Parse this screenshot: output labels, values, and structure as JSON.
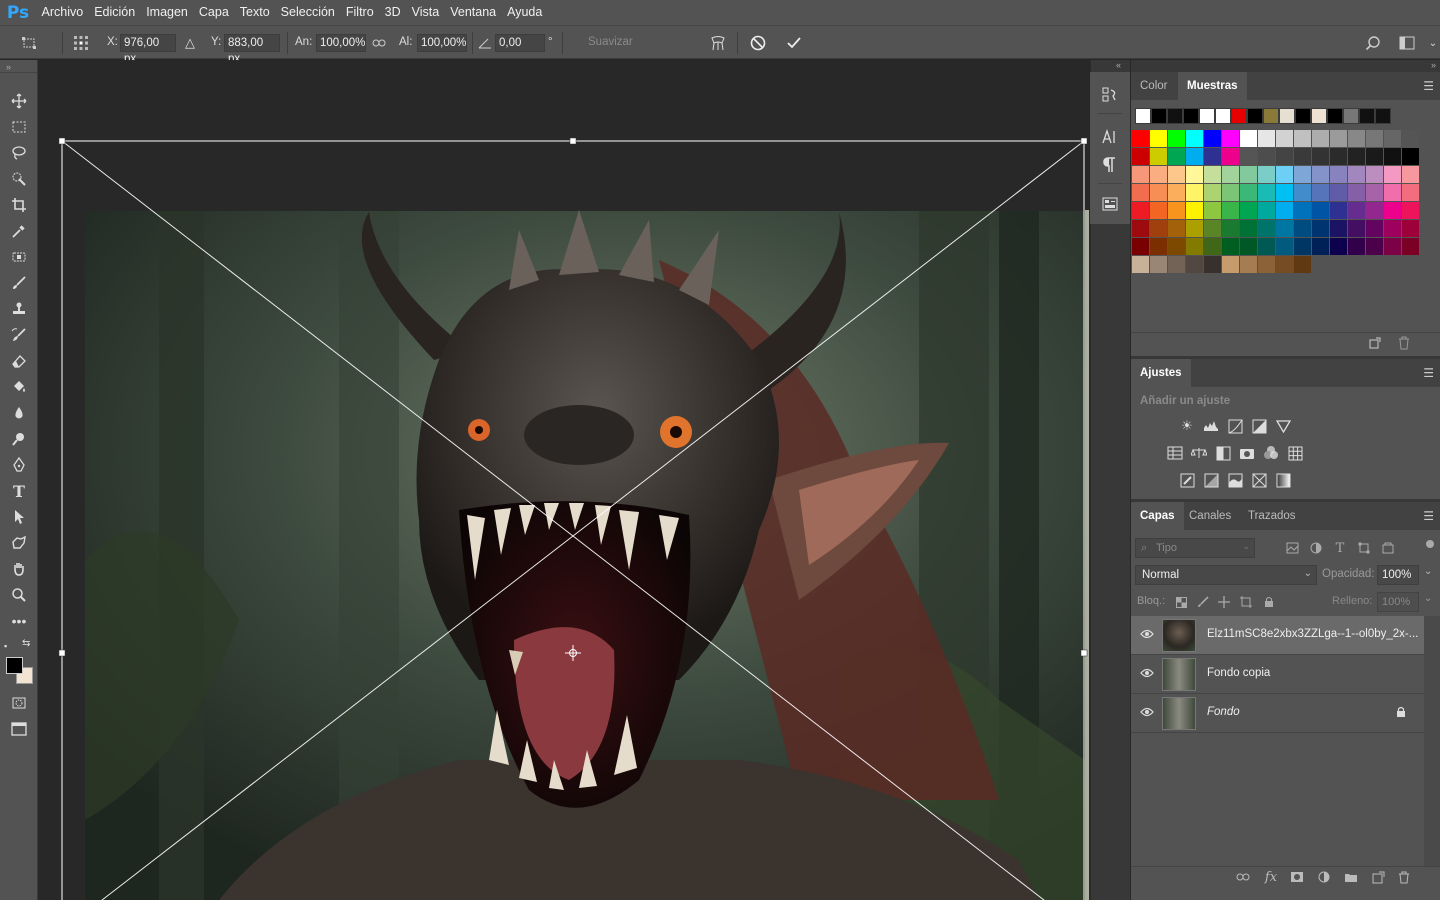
{
  "app": {
    "logo": "Ps"
  },
  "menu": [
    "Archivo",
    "Edición",
    "Imagen",
    "Capa",
    "Texto",
    "Selección",
    "Filtro",
    "3D",
    "Vista",
    "Ventana",
    "Ayuda"
  ],
  "options": {
    "x_label": "X:",
    "x_value": "976,00 px",
    "y_label": "Y:",
    "y_value": "883,00 px",
    "w_label": "An:",
    "w_value": "100,00%",
    "h_label": "Al:",
    "h_value": "100,00%",
    "angle_value": "0,00",
    "angle_unit": "°",
    "smooth_label": "Suavizar"
  },
  "color_panel": {
    "tabs": [
      "Color",
      "Muestras"
    ],
    "active_tab": "Muestras",
    "recent_swatches": [
      "#ffffff",
      "#000000",
      "#111111",
      "#000000",
      "#ffffff",
      "#ffffff",
      "#e60000",
      "#000000",
      "#8a7a3a",
      "#e6e0d2",
      "#000000",
      "#f0e2d2",
      "#000000",
      "#777777",
      "#111111",
      "#111111"
    ],
    "grid_swatches": [
      [
        "#ff0000",
        "#ffff00",
        "#00ff00",
        "#00ffff",
        "#0000ff",
        "#ff00ff",
        "#ffffff",
        "#e6e6e6",
        "#d2d2d2",
        "#c0c0c0",
        "#adadad",
        "#9b9b9b",
        "#888888",
        "#777777",
        "#666666",
        "#555555"
      ],
      [
        "#cc0000",
        "#cccc00",
        "#00a651",
        "#00aeef",
        "#2e3192",
        "#ec008c",
        "#555555",
        "#4d4d4d",
        "#444444",
        "#3a3a3a",
        "#333333",
        "#2b2b2b",
        "#222222",
        "#1a1a1a",
        "#111111",
        "#000000"
      ],
      [
        "#f7977a",
        "#f9ad81",
        "#fdc68a",
        "#fff79a",
        "#c4df9b",
        "#a3d39c",
        "#82ca9d",
        "#7bcdc8",
        "#6ecff6",
        "#7ea7d8",
        "#8493ca",
        "#8882be",
        "#a187be",
        "#bc8dbf",
        "#f49ac2",
        "#f6989d"
      ],
      [
        "#f26c4f",
        "#f68e55",
        "#fbaf5c",
        "#fff467",
        "#acd372",
        "#7cc576",
        "#3bb878",
        "#1abbb4",
        "#00bff3",
        "#438ccb",
        "#5574b9",
        "#605ca8",
        "#855fa8",
        "#a763a8",
        "#f06eaa",
        "#f26d7d"
      ],
      [
        "#ed1c24",
        "#f26522",
        "#f7941d",
        "#fff200",
        "#8dc73f",
        "#39b54a",
        "#00a651",
        "#00a99d",
        "#00aeef",
        "#0072bc",
        "#0054a6",
        "#2e3192",
        "#662d91",
        "#92278f",
        "#ec008c",
        "#ed145b"
      ],
      [
        "#9e0b0f",
        "#a0410d",
        "#a36209",
        "#aba000",
        "#598527",
        "#1a7b30",
        "#007236",
        "#00746b",
        "#0076a3",
        "#004b80",
        "#003471",
        "#1b1464",
        "#440e62",
        "#630460",
        "#9e005d",
        "#9e0039"
      ],
      [
        "#790000",
        "#7b2e00",
        "#7d4900",
        "#827b00",
        "#406618",
        "#005e20",
        "#005826",
        "#005952",
        "#005b7f",
        "#003663",
        "#002157",
        "#0d004c",
        "#32004b",
        "#4b0049",
        "#7b0046",
        "#7a0026"
      ],
      [
        "#c7b299",
        "#998675",
        "#736357",
        "#534741",
        "#37302d",
        "#c69c6d",
        "#a67c52",
        "#8c6239",
        "#754c24",
        "#603913"
      ]
    ]
  },
  "adjustments_panel": {
    "title": "Ajustes",
    "subtitle": "Añadir un ajuste"
  },
  "layers_panel": {
    "tabs": [
      "Capas",
      "Canales",
      "Trazados"
    ],
    "active_tab": "Capas",
    "filter_placeholder": "Tipo",
    "blend_mode": "Normal",
    "opacity_label": "Opacidad:",
    "opacity_value": "100%",
    "lock_label": "Bloq.:",
    "fill_label": "Relleno:",
    "fill_value": "100%",
    "layers": [
      {
        "name": "Elz11mSC8e2xbx3ZZLga--1--ol0by_2x-...",
        "visible": true,
        "selected": true,
        "locked": false
      },
      {
        "name": "Fondo copia",
        "visible": true,
        "selected": false,
        "locked": false
      },
      {
        "name": "Fondo",
        "visible": true,
        "selected": false,
        "locked": true
      }
    ]
  },
  "colors": {
    "ui_dark": "#535353",
    "canvas_bg": "#282828",
    "accent": "#31a8ff"
  }
}
